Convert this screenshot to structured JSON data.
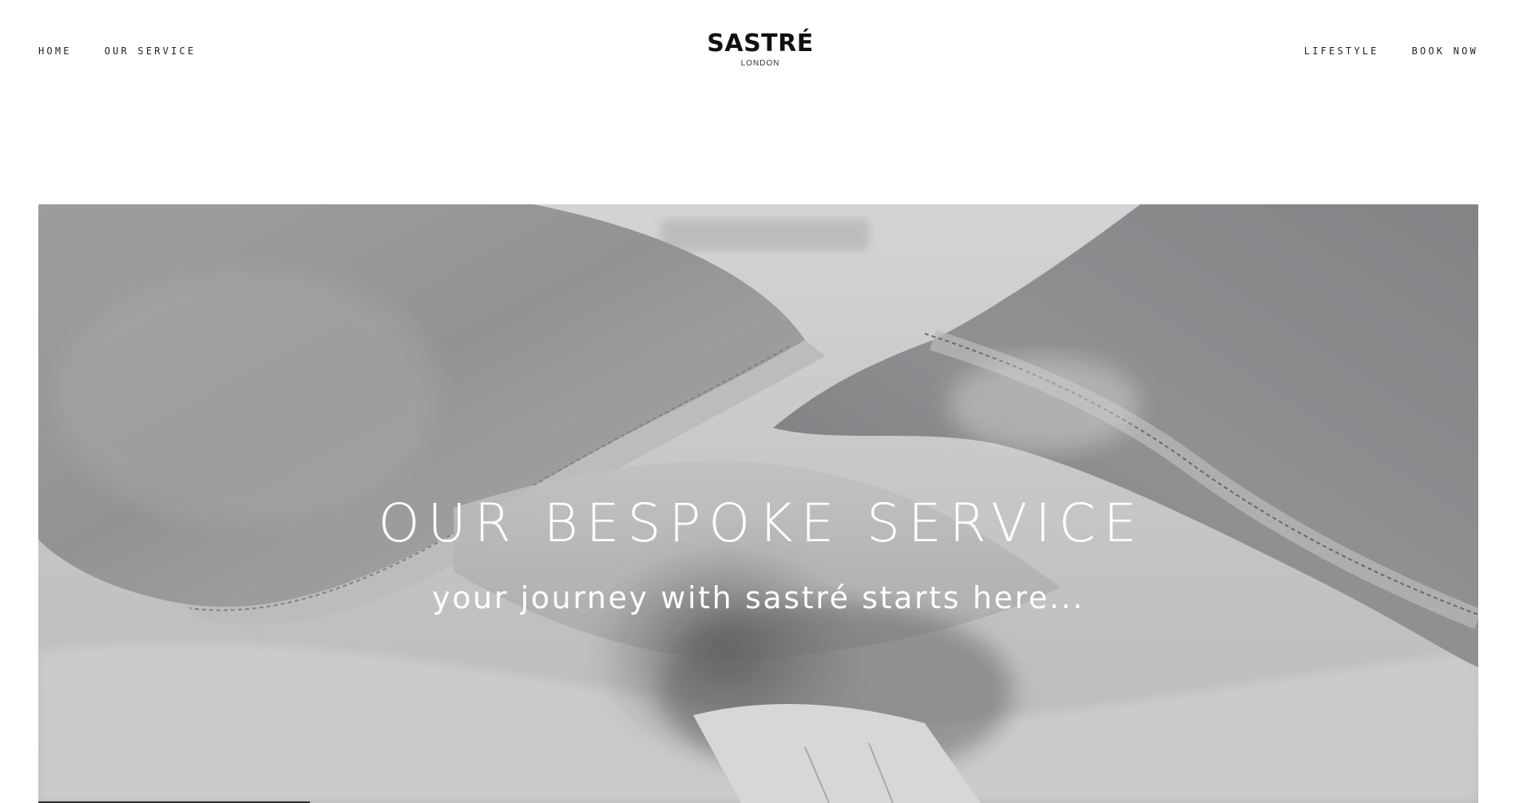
{
  "header": {
    "nav_left": [
      {
        "label": "HOME"
      },
      {
        "label": "OUR SERVICE"
      }
    ],
    "brand": {
      "name": "SASTRÉ",
      "sub": "LONDON"
    },
    "nav_right": [
      {
        "label": "LIFESTYLE"
      },
      {
        "label": "BOOK NOW"
      }
    ]
  },
  "hero": {
    "title": "OUR BESPOKE SERVICE",
    "subtitle": "your journey with sastré starts here...",
    "image": "shirt-collar-closeup-photo"
  },
  "colors": {
    "text": "#222222",
    "hero_text": "#ffffff",
    "background": "#ffffff"
  }
}
